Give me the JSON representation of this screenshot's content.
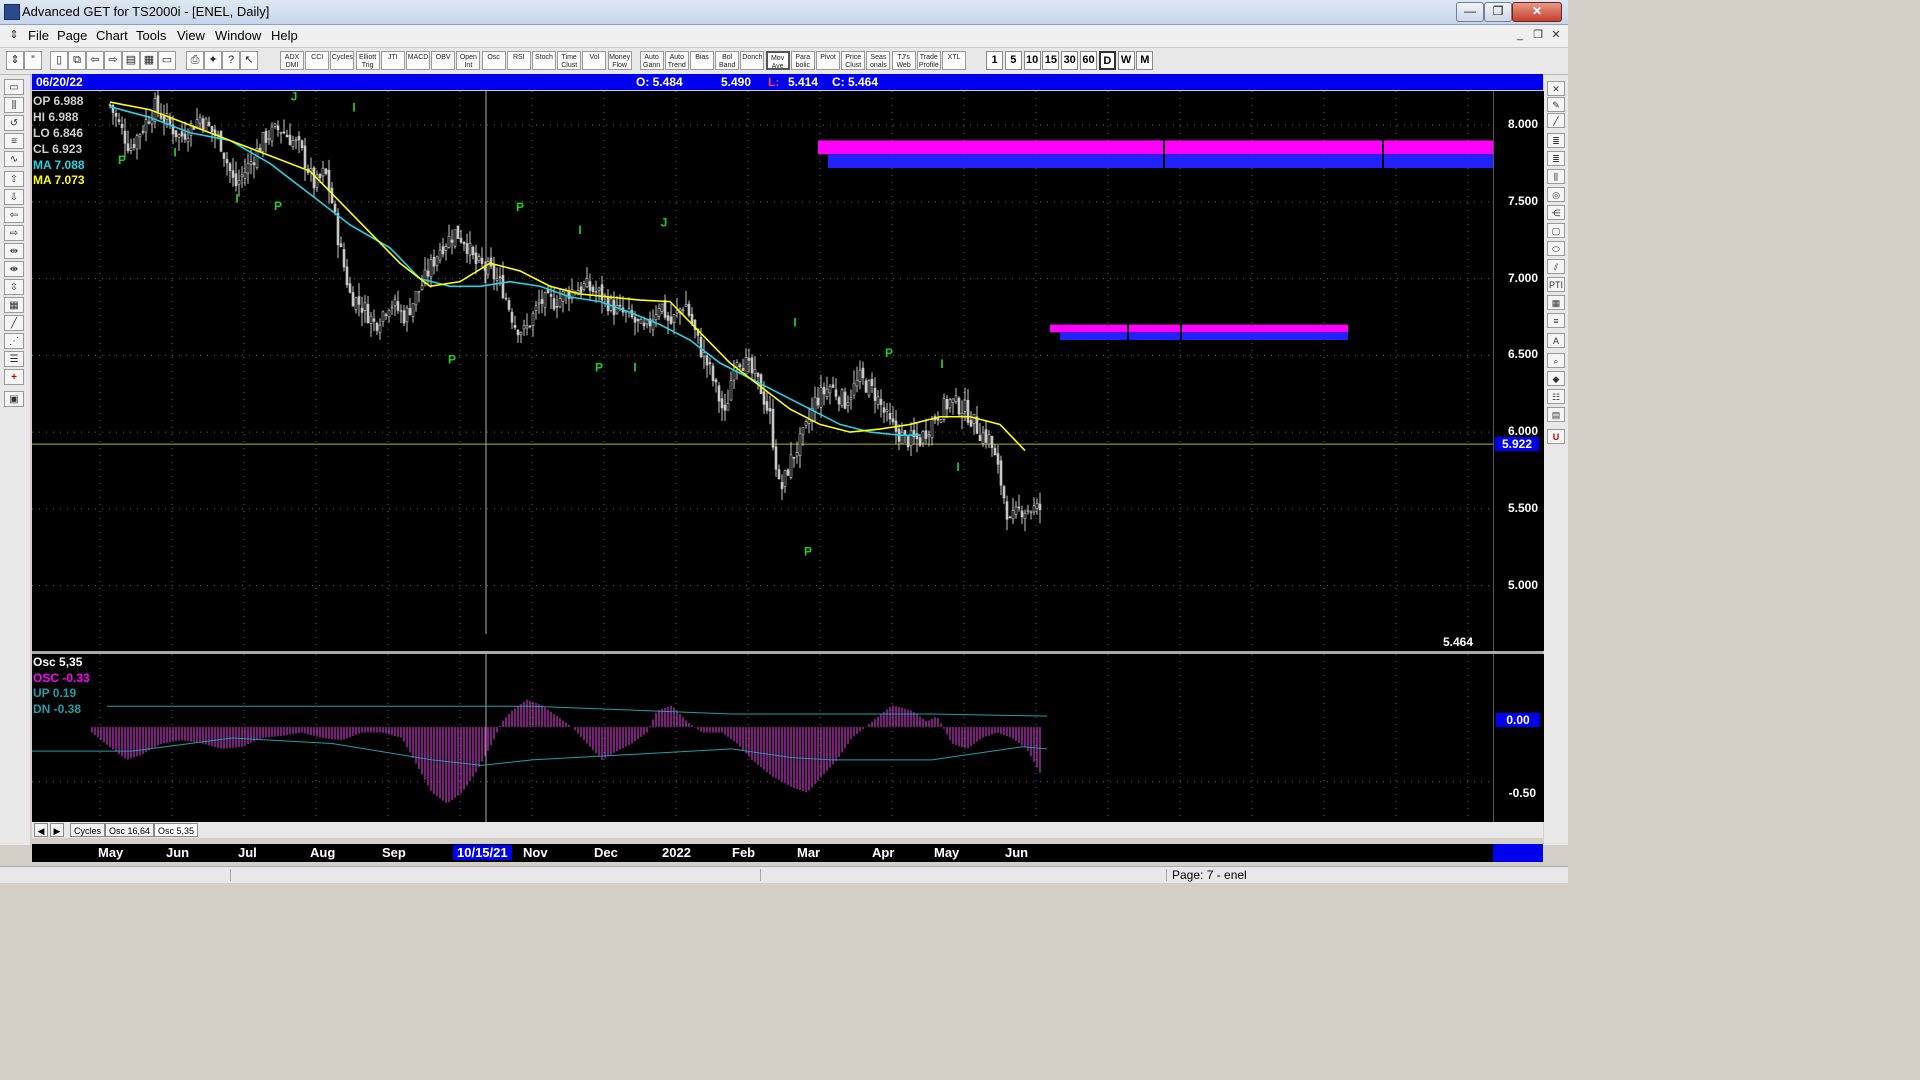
{
  "window": {
    "title": "Advanced GET for TS2000i - [ENEL, Daily]",
    "min_glyph": "—",
    "max_glyph": "❐",
    "close_glyph": "✕"
  },
  "menu": [
    {
      "key": "file",
      "label": "File"
    },
    {
      "key": "page",
      "label": "Page"
    },
    {
      "key": "chart",
      "label": "Chart"
    },
    {
      "key": "tools",
      "label": "Tools"
    },
    {
      "key": "view",
      "label": "View"
    },
    {
      "key": "window",
      "label": "Window"
    },
    {
      "key": "help",
      "label": "Help"
    }
  ],
  "toolbar": {
    "indicators": [
      "ADX DMI",
      "CCI",
      "Cycles",
      "Elliott Trig",
      "JTI",
      "MACD",
      "OBV",
      "Open Int",
      "Osc",
      "RSI",
      "Stoch",
      "Time Clust",
      "Vol",
      "Money Flow",
      "Auto Gann",
      "Auto Trend",
      "Bias",
      "Bol Band",
      "Donch",
      "Mov Ave",
      "Para bolic",
      "Pivot",
      "Price Clust",
      "Seas onals",
      "TJ's Web",
      "Trade Profile",
      "XTL"
    ],
    "timeframes": [
      "1",
      "5",
      "10",
      "15",
      "30",
      "60",
      "D",
      "W",
      "M"
    ],
    "selected_timeframe": "D"
  },
  "infobar": {
    "date": "06/20/22",
    "open": "O: 5.484",
    "high": "5.490",
    "low_label": "L:",
    "low_value": "5.414",
    "close": "C: 5.464"
  },
  "legend": {
    "op": "OP 6.988",
    "hi": "HI  6.988",
    "lo": "LO  6.846",
    "cl": "CL  6.923",
    "ma1": "MA 7.088",
    "ma2": "MA 7.073"
  },
  "price_axis": {
    "ticks": [
      "8.000",
      "7.500",
      "7.000",
      "6.500",
      "6.000",
      "5.500",
      "5.000"
    ],
    "current_price": "5.922",
    "last_price": "5.464"
  },
  "osc": {
    "title": "Osc 5,35",
    "osc_label": "OSC -0.33",
    "up_label": "UP  0.19",
    "dn_label": "DN  -0.38",
    "axis_ticks": [
      "0.00",
      "-0.50"
    ]
  },
  "tabs": [
    "Cycles",
    "Osc 16,64",
    "Osc 5,35"
  ],
  "dates": {
    "months": [
      "May",
      "Jun",
      "Jul",
      "Aug",
      "Sep",
      "Nov",
      "Dec",
      "2022",
      "Feb",
      "Mar",
      "Apr",
      "May",
      "Jun"
    ],
    "selected_date": "10/15/21"
  },
  "wave_labels": [
    "P",
    "I",
    "I",
    "P",
    "J",
    "I",
    "P",
    "P",
    "I",
    "P",
    "J",
    "I",
    "P",
    "P",
    "I",
    "I",
    "I"
  ],
  "status": {
    "page": "Page: 7 - enel"
  },
  "colors": {
    "background": "#000000",
    "bars": "#c8c8c8",
    "ma_fast": "#ffff00",
    "ma_slow": "#22d3e6",
    "label_green": "#22cc22",
    "zone_magenta": "#ff00ff",
    "zone_blue": "#2222ff",
    "osc_histogram": "#cc33cc",
    "osc_bands": "#1f9fa8",
    "infobar_blue": "#0000ee"
  },
  "chart_data": {
    "type": "candlestick",
    "ylim": [
      4.6,
      8.17
    ],
    "price_ticks": [
      8.0,
      7.5,
      7.0,
      6.5,
      6.0,
      5.5,
      5.0
    ],
    "horizontal_line": 5.922,
    "ohlc_summary": {
      "date": "06/20/22",
      "open": 5.484,
      "high": 5.49,
      "low": 5.414,
      "close": 5.464
    },
    "close_path": [
      [
        0,
        8.13
      ],
      [
        20,
        7.85
      ],
      [
        45,
        8.12
      ],
      [
        70,
        7.92
      ],
      [
        90,
        8.05
      ],
      [
        110,
        7.9
      ],
      [
        125,
        7.6
      ],
      [
        140,
        7.75
      ],
      [
        155,
        7.92
      ],
      [
        170,
        7.98
      ],
      [
        190,
        7.85
      ],
      [
        205,
        7.6
      ],
      [
        215,
        7.7
      ],
      [
        222,
        7.5
      ],
      [
        230,
        7.2
      ],
      [
        240,
        6.9
      ],
      [
        255,
        6.8
      ],
      [
        265,
        6.7
      ],
      [
        280,
        6.85
      ],
      [
        295,
        6.75
      ],
      [
        315,
        7.0
      ],
      [
        330,
        7.2
      ],
      [
        345,
        7.3
      ],
      [
        355,
        7.25
      ],
      [
        365,
        7.1
      ],
      [
        380,
        7.05
      ],
      [
        392,
        6.95
      ],
      [
        405,
        6.7
      ],
      [
        415,
        6.65
      ],
      [
        430,
        6.85
      ],
      [
        445,
        6.85
      ],
      [
        460,
        6.92
      ],
      [
        475,
        6.95
      ],
      [
        490,
        6.9
      ],
      [
        505,
        6.8
      ],
      [
        520,
        6.75
      ],
      [
        535,
        6.65
      ],
      [
        550,
        6.85
      ],
      [
        560,
        6.7
      ],
      [
        575,
        6.85
      ],
      [
        590,
        6.55
      ],
      [
        600,
        6.4
      ],
      [
        615,
        6.1
      ],
      [
        625,
        6.5
      ],
      [
        635,
        6.45
      ],
      [
        650,
        6.3
      ],
      [
        660,
        6.1
      ],
      [
        670,
        5.6
      ],
      [
        680,
        5.8
      ],
      [
        695,
        6.0
      ],
      [
        705,
        6.2
      ],
      [
        720,
        6.3
      ],
      [
        735,
        6.2
      ],
      [
        750,
        6.35
      ],
      [
        765,
        6.25
      ],
      [
        780,
        6.05
      ],
      [
        795,
        5.95
      ],
      [
        810,
        5.95
      ],
      [
        825,
        6.1
      ],
      [
        840,
        6.2
      ],
      [
        855,
        6.15
      ],
      [
        870,
        6.0
      ],
      [
        880,
        5.95
      ],
      [
        890,
        5.7
      ],
      [
        900,
        5.4
      ],
      [
        910,
        5.5
      ]
    ],
    "ma_fast": [
      [
        0,
        8.15
      ],
      [
        40,
        8.1
      ],
      [
        80,
        8.0
      ],
      [
        120,
        7.9
      ],
      [
        160,
        7.8
      ],
      [
        200,
        7.7
      ],
      [
        230,
        7.5
      ],
      [
        260,
        7.3
      ],
      [
        290,
        7.1
      ],
      [
        320,
        6.95
      ],
      [
        350,
        6.98
      ],
      [
        380,
        7.1
      ],
      [
        410,
        7.05
      ],
      [
        440,
        6.95
      ],
      [
        470,
        6.9
      ],
      [
        500,
        6.88
      ],
      [
        530,
        6.86
      ],
      [
        560,
        6.85
      ],
      [
        590,
        6.65
      ],
      [
        620,
        6.45
      ],
      [
        650,
        6.3
      ],
      [
        680,
        6.15
      ],
      [
        710,
        6.05
      ],
      [
        740,
        6.0
      ],
      [
        770,
        6.02
      ],
      [
        800,
        6.05
      ],
      [
        830,
        6.1
      ],
      [
        860,
        6.1
      ],
      [
        890,
        6.05
      ],
      [
        915,
        5.88
      ]
    ],
    "ma_slow": [
      [
        0,
        8.12
      ],
      [
        40,
        8.05
      ],
      [
        80,
        7.95
      ],
      [
        120,
        7.9
      ],
      [
        160,
        7.75
      ],
      [
        200,
        7.55
      ],
      [
        240,
        7.35
      ],
      [
        280,
        7.2
      ],
      [
        310,
        7.0
      ],
      [
        340,
        6.95
      ],
      [
        370,
        6.95
      ],
      [
        400,
        6.98
      ],
      [
        430,
        6.95
      ],
      [
        460,
        6.88
      ],
      [
        490,
        6.85
      ],
      [
        520,
        6.78
      ],
      [
        550,
        6.7
      ],
      [
        580,
        6.6
      ],
      [
        610,
        6.45
      ],
      [
        640,
        6.35
      ],
      [
        670,
        6.25
      ],
      [
        700,
        6.15
      ],
      [
        730,
        6.05
      ],
      [
        760,
        6.0
      ],
      [
        790,
        5.98
      ],
      [
        810,
        5.98
      ]
    ],
    "wave_points": [
      {
        "x": 90,
        "price": 7.85,
        "label": "P",
        "pos": "below"
      },
      {
        "x": 143,
        "price": 7.9,
        "label": "I",
        "pos": "below"
      },
      {
        "x": 205,
        "price": 7.6,
        "label": "I",
        "pos": "below"
      },
      {
        "x": 246,
        "price": 7.55,
        "label": "P",
        "pos": "below"
      },
      {
        "x": 262,
        "price": 8.12,
        "label": "J",
        "pos": "above"
      },
      {
        "x": 322,
        "price": 8.05,
        "label": "I",
        "pos": "above"
      },
      {
        "x": 420,
        "price": 6.55,
        "label": "P",
        "pos": "below"
      },
      {
        "x": 488,
        "price": 7.4,
        "label": "P",
        "pos": "above"
      },
      {
        "x": 548,
        "price": 7.25,
        "label": "I",
        "pos": "above"
      },
      {
        "x": 567,
        "price": 6.5,
        "label": "P",
        "pos": "below"
      },
      {
        "x": 632,
        "price": 7.3,
        "label": "J",
        "pos": "above"
      },
      {
        "x": 603,
        "price": 6.5,
        "label": "I",
        "pos": "below"
      },
      {
        "x": 763,
        "price": 6.65,
        "label": "I",
        "pos": "above"
      },
      {
        "x": 776,
        "price": 5.3,
        "label": "P",
        "pos": "below"
      },
      {
        "x": 857,
        "price": 6.45,
        "label": "P",
        "pos": "above"
      },
      {
        "x": 910,
        "price": 6.38,
        "label": "I",
        "pos": "above"
      },
      {
        "x": 926,
        "price": 5.85,
        "label": "I",
        "pos": "below"
      }
    ],
    "zones": [
      {
        "x0": 786,
        "x1": 1461,
        "hi": 7.9,
        "lo": 7.72
      },
      {
        "x0": 1018,
        "x1": 1316,
        "hi": 6.7,
        "lo": 6.6
      }
    ],
    "osc_ylim": [
      0.65,
      -0.85
    ],
    "osc_series": [
      [
        60,
        -0.05
      ],
      [
        80,
        -0.2
      ],
      [
        95,
        -0.3
      ],
      [
        110,
        -0.25
      ],
      [
        130,
        -0.15
      ],
      [
        150,
        -0.12
      ],
      [
        170,
        -0.15
      ],
      [
        190,
        -0.2
      ],
      [
        210,
        -0.18
      ],
      [
        230,
        -0.1
      ],
      [
        250,
        -0.08
      ],
      [
        270,
        -0.05
      ],
      [
        290,
        -0.1
      ],
      [
        310,
        -0.12
      ],
      [
        330,
        -0.05
      ],
      [
        350,
        -0.05
      ],
      [
        370,
        -0.1
      ],
      [
        385,
        -0.35
      ],
      [
        400,
        -0.6
      ],
      [
        415,
        -0.7
      ],
      [
        430,
        -0.6
      ],
      [
        445,
        -0.4
      ],
      [
        460,
        -0.15
      ],
      [
        470,
        0.05
      ],
      [
        480,
        0.15
      ],
      [
        495,
        0.25
      ],
      [
        510,
        0.2
      ],
      [
        525,
        0.1
      ],
      [
        540,
        0.0
      ],
      [
        555,
        -0.15
      ],
      [
        570,
        -0.3
      ],
      [
        585,
        -0.22
      ],
      [
        600,
        -0.15
      ],
      [
        615,
        -0.05
      ],
      [
        625,
        0.15
      ],
      [
        640,
        0.2
      ],
      [
        655,
        0.05
      ],
      [
        670,
        -0.05
      ],
      [
        690,
        -0.05
      ],
      [
        705,
        -0.15
      ],
      [
        720,
        -0.3
      ],
      [
        740,
        -0.45
      ],
      [
        760,
        -0.55
      ],
      [
        775,
        -0.6
      ],
      [
        790,
        -0.45
      ],
      [
        805,
        -0.3
      ],
      [
        820,
        -0.1
      ],
      [
        840,
        0.05
      ],
      [
        860,
        0.2
      ],
      [
        880,
        0.15
      ],
      [
        895,
        0.05
      ],
      [
        905,
        0.1
      ],
      [
        920,
        -0.15
      ],
      [
        935,
        -0.2
      ],
      [
        950,
        -0.1
      ],
      [
        965,
        -0.05
      ],
      [
        980,
        -0.1
      ],
      [
        995,
        -0.2
      ],
      [
        1010,
        -0.45
      ]
    ],
    "osc_up_band": [
      [
        75,
        0.19
      ],
      [
        300,
        0.19
      ],
      [
        500,
        0.19
      ],
      [
        700,
        0.12
      ],
      [
        900,
        0.12
      ],
      [
        1015,
        0.1
      ]
    ],
    "osc_dn_band": [
      [
        0,
        -0.22
      ],
      [
        100,
        -0.22
      ],
      [
        200,
        -0.1
      ],
      [
        300,
        -0.15
      ],
      [
        400,
        -0.3
      ],
      [
        450,
        -0.35
      ],
      [
        500,
        -0.3
      ],
      [
        600,
        -0.25
      ],
      [
        700,
        -0.2
      ],
      [
        760,
        -0.28
      ],
      [
        800,
        -0.3
      ],
      [
        900,
        -0.3
      ],
      [
        990,
        -0.18
      ],
      [
        1015,
        -0.2
      ]
    ],
    "vertical_cursor_x": 454
  }
}
